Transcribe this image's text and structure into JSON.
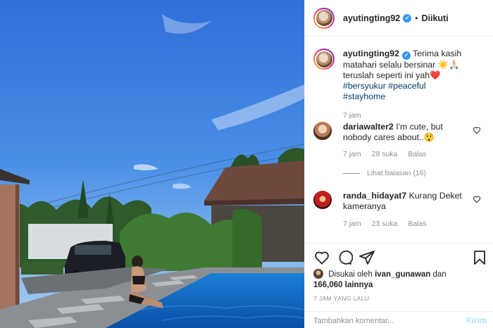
{
  "post": {
    "username": "ayutingting92",
    "follow_state": "Diikuti",
    "caption": {
      "text": "Terima kasih matahari selalu bersinar ☀️🙏🏻 teruslah seperti ini yah❤️",
      "hashtags": [
        "#bersyukur",
        "#peaceful",
        "#stayhome"
      ]
    },
    "caption_time": "7 jam"
  },
  "comments": [
    {
      "username": "dariawalter2",
      "text": "I'm cute, but nobody cares about..😲",
      "time": "7 jam",
      "likes": "28 suka",
      "reply_label": "Balas",
      "view_replies": "Lihat balasan (16)"
    },
    {
      "username": "randa_hidayat7",
      "text": "Kurang Deket kameranya",
      "time": "7 jam",
      "likes": "23 suka",
      "reply_label": "Balas"
    }
  ],
  "likes": {
    "prefix": "Disukai oleh",
    "user": "ivan_gunawan",
    "joiner": "dan",
    "others": "166,060 lainnya"
  },
  "time_ago": "7 JAM YANG LALU",
  "comment_box": {
    "placeholder": "Tambahkan komentar...",
    "post_label": "Kirim"
  },
  "icons": {
    "verified": "verified-badge-icon",
    "like": "heart-icon",
    "comment": "comment-bubble-icon",
    "share": "paper-plane-icon",
    "save": "bookmark-icon"
  },
  "colors": {
    "verified_blue": "#3897f0",
    "hashtag": "#00376b",
    "muted": "#8e8e8e",
    "post_button_disabled": "#b2dffc",
    "heart_red": "#ed4956"
  }
}
